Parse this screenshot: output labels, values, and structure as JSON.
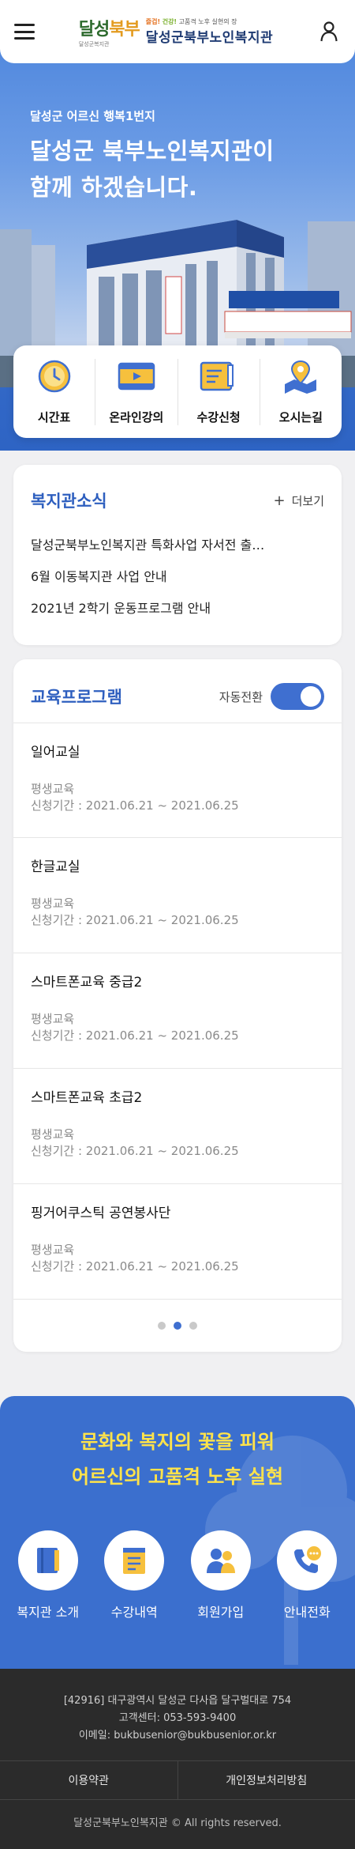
{
  "header": {
    "logo_mark_1": "달성",
    "logo_mark_2": "북부",
    "logo_mark_sub": "달성군복지관",
    "slogan_1": "즐겁!",
    "slogan_2": "건강!",
    "slogan_3": "고품격 노후 실현의 장",
    "logo_name": "달성군북부노인복지관"
  },
  "hero": {
    "kicker": "달성군 어르신 행복1번지",
    "title_line1": "달성군 북부노인복지관이",
    "title_line2": "함께 하겠습니다."
  },
  "quick_menu": [
    {
      "label": "시간표",
      "icon": "clock-icon"
    },
    {
      "label": "온라인강의",
      "icon": "video-play-icon"
    },
    {
      "label": "수강신청",
      "icon": "document-pen-icon"
    },
    {
      "label": "오시는길",
      "icon": "map-pin-icon"
    }
  ],
  "news": {
    "title": "복지관소식",
    "more_label": "더보기",
    "items": [
      "달성군북부노인복지관 특화사업 자서전 출…",
      "6월 이동복지관 사업 안내",
      "2021년 2학기 운동프로그램 안내"
    ]
  },
  "education": {
    "title": "교육프로그램",
    "toggle_label": "자동전환",
    "programs": [
      {
        "name": "일어교실",
        "category": "평생교육",
        "period": "신청기간 : 2021.06.21 ~ 2021.06.25"
      },
      {
        "name": "한글교실",
        "category": "평생교육",
        "period": "신청기간 : 2021.06.21 ~ 2021.06.25"
      },
      {
        "name": "스마트폰교육 중급2",
        "category": "평생교육",
        "period": "신청기간 : 2021.06.21 ~ 2021.06.25"
      },
      {
        "name": "스마트폰교육 초급2",
        "category": "평생교육",
        "period": "신청기간 : 2021.06.21 ~ 2021.06.25"
      },
      {
        "name": "핑거어쿠스틱 공연봉사단",
        "category": "평생교육",
        "period": "신청기간 : 2021.06.21 ~ 2021.06.25"
      }
    ],
    "pager_active": 2
  },
  "band": {
    "slogan_line1": "문화와 복지의 꽃을 피워",
    "slogan_line2": "어르신의 고품격 노후 실현",
    "menu": [
      {
        "label": "복지관 소개",
        "icon": "book-icon"
      },
      {
        "label": "수강내역",
        "icon": "notepad-icon"
      },
      {
        "label": "회원가입",
        "icon": "users-icon"
      },
      {
        "label": "안내전화",
        "icon": "phone-chat-icon"
      }
    ]
  },
  "footer": {
    "address": "[42916] 대구광역시 달성군 다사읍 달구벌대로 754",
    "phone": "고객센터: 053-593-9400",
    "email": "이메일: bukbusenior@bukbusenior.or.kr",
    "terms": "이용약관",
    "privacy": "개인정보처리방침",
    "copyright": "달성군북부노인복지관 © All rights reserved."
  },
  "colors": {
    "primary": "#3b6fce",
    "title_blue": "#2e5fbf",
    "slogan_yellow": "#ffe34a",
    "footer_bg": "#2b2b2b"
  }
}
